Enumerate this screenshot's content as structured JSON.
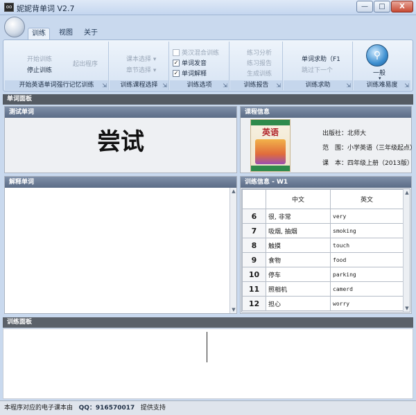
{
  "window": {
    "title": "妮妮背单词 V2.7",
    "icon_text": "oo",
    "min_label": "—",
    "max_label": "□",
    "close_label": "X"
  },
  "tabs": [
    "训练",
    "视图",
    "关于"
  ],
  "ribbon": {
    "group1": {
      "start": "开始训练",
      "stop": "停止训练",
      "custom": "起出程序",
      "label": "开始英语单词强行记忆训练"
    },
    "group2": {
      "textbook": "课本选择",
      "chapter": "章节选择",
      "label": "训练课程选择"
    },
    "group3": {
      "mix": "英汉混合训练",
      "pron": "单词发音",
      "explain": "单词解释",
      "label": "训练选项",
      "mix_checked": "",
      "pron_checked": "✓",
      "explain_checked": "✓"
    },
    "group4": {
      "analysis": "练习分析",
      "report": "练习报告",
      "generate": "生成训练",
      "label": "训练报告"
    },
    "group5": {
      "help": "单词求助（F1",
      "next": "跳过下一个",
      "label": "训练求助"
    },
    "group6": {
      "level": "一般",
      "icon_glyph": "⚲",
      "label": "训练难易度"
    }
  },
  "panels": {
    "word_panel": "单词面板",
    "test_word_head": "测试单词",
    "test_word": "尝试",
    "course_head": "课程信息",
    "book_title": "英语",
    "publisher": "出版社：北师大",
    "scope": "范　围：小学英语（三年级起点）",
    "lesson": "课　本：四年级上册（2013版）",
    "explain_head": "解释单词",
    "train_info_head": "训练信息 - W1",
    "train_panel": "训练面板"
  },
  "vocab_table": {
    "headers": [
      "",
      "中文",
      "英文"
    ],
    "rows": [
      {
        "num": "6",
        "cn": "很, 非常",
        "en": "very"
      },
      {
        "num": "7",
        "cn": "吸烟, 抽烟",
        "en": "smoking"
      },
      {
        "num": "8",
        "cn": "触摸",
        "en": "touch"
      },
      {
        "num": "9",
        "cn": "食物",
        "en": "food"
      },
      {
        "num": "10",
        "cn": "停车",
        "en": "parking"
      },
      {
        "num": "11",
        "cn": "照相机",
        "en": "camerd"
      },
      {
        "num": "12",
        "cn": "担心",
        "en": "worry"
      }
    ]
  },
  "status": {
    "prefix": "本程序对应的电子课本由",
    "qq": "QQ：916570017",
    "suffix": "提供支持"
  }
}
